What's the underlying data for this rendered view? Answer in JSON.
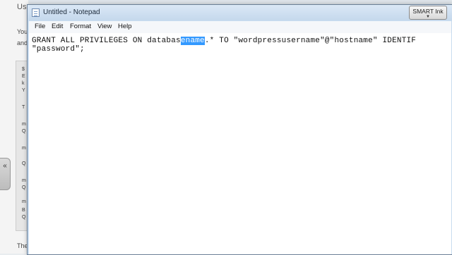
{
  "background": {
    "heading": "Us",
    "lines": [
      "You",
      "and"
    ],
    "side_tab_glyph": "«",
    "panel_letters": [
      "$",
      "E",
      "k",
      "Y",
      "T",
      "m",
      "Q",
      "m",
      "Q",
      "m",
      "Q",
      "m",
      "B",
      "Q",
      "The"
    ]
  },
  "window": {
    "title": "Untitled - Notepad",
    "icon": "notepad-icon"
  },
  "smart_ink": {
    "label": "SMART Ink",
    "arrow": "▼"
  },
  "menu": {
    "items": [
      "File",
      "Edit",
      "Format",
      "View",
      "Help"
    ]
  },
  "editor": {
    "line1_before": "GRANT ALL PRIVILEGES ON databas",
    "line1_selected": "ename",
    "line1_after": ".* TO \"wordpressusername\"@\"hostname\" IDENTIF",
    "line2": "\"password\";"
  }
}
